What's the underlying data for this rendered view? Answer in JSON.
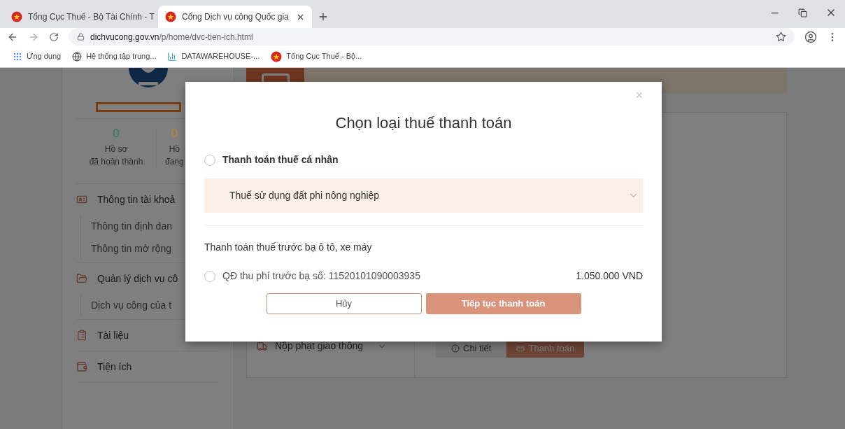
{
  "browser": {
    "tabs": [
      {
        "title": "Tổng Cục Thuế - Bộ Tài Chính - T",
        "selected": false
      },
      {
        "title": "Cổng Dịch vụ công Quốc gia",
        "selected": true
      }
    ],
    "url_host": "dichvucong.gov.vn",
    "url_path": "/p/home/dvc-tien-ich.html",
    "bookmarks": [
      {
        "label": "Ứng dụng",
        "kind": "apps"
      },
      {
        "label": "Hệ thống tập trung...",
        "kind": "globe"
      },
      {
        "label": "DATAWAREHOUSE-...",
        "kind": "data"
      },
      {
        "label": "Tổng Cục Thuế - Bộ...",
        "kind": "emblem"
      }
    ]
  },
  "sidebar": {
    "stats": [
      {
        "count": "0",
        "label": "Hồ sơ",
        "sublabel": "đã hoàn thành",
        "color": "#2f7a55"
      },
      {
        "count": "0",
        "label": "Hồ",
        "sublabel": "đang",
        "color": "#b68a20"
      }
    ],
    "menu": [
      {
        "label": "Thông tin tài khoả",
        "kind": "account",
        "children": [
          {
            "label": "Thông tin định dan"
          },
          {
            "label": "Thông tin mở rộng"
          }
        ]
      },
      {
        "label": "Quản lý dịch vụ cô",
        "kind": "folder",
        "children": [
          {
            "label": "Dịch vụ công của t"
          }
        ]
      },
      {
        "label": "Tài liệu",
        "kind": "document"
      },
      {
        "label": "Tiện ích",
        "kind": "wallet"
      }
    ]
  },
  "main": {
    "service_select": "Nộp phạt giao thông",
    "detail_button": "Chi tiết",
    "pay_button": "Thanh toán"
  },
  "modal": {
    "close": "×",
    "title": "Chọn loại thuế thanh toán",
    "personal_option": {
      "label": "Thanh toán thuế cá nhân",
      "selected": false
    },
    "tax_type_select": "Thuế sử dụng đất phi nông nghiệp",
    "section_label": "Thanh toán thuế trước bạ ô tô, xe máy",
    "registration_fee": {
      "label": "QĐ thu phí trước bạ số: 11520101090003935",
      "amount": "1.050.000 VND",
      "selected": false
    },
    "cancel_button": "Hủy",
    "continue_button": "Tiếp tục thanh toán"
  }
}
